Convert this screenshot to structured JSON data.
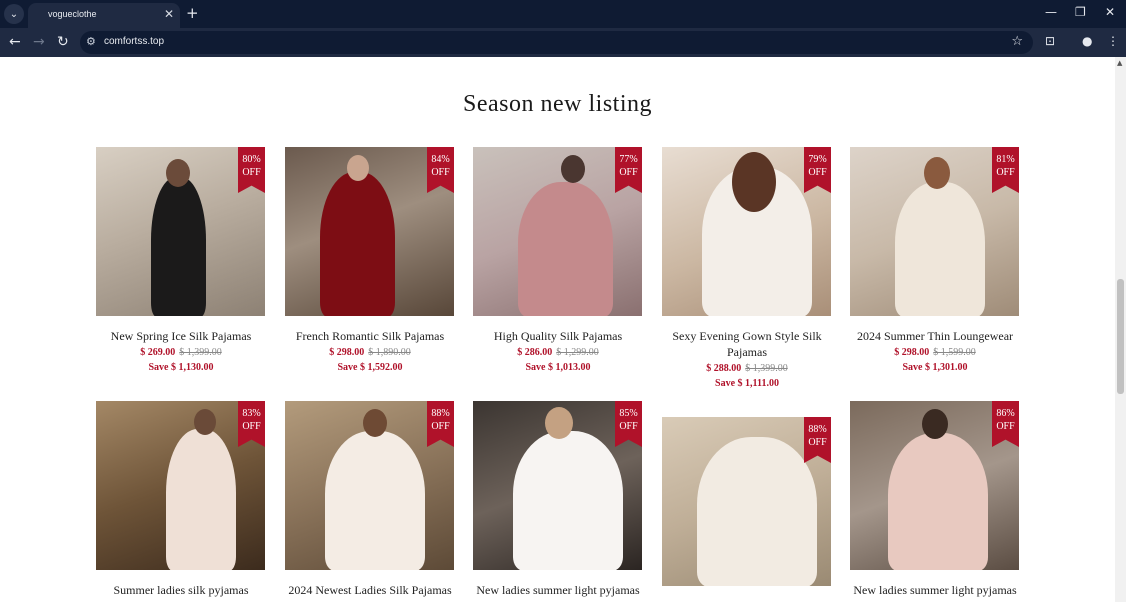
{
  "browser": {
    "tab_title": "vogueclothe",
    "url": "comfortss.top"
  },
  "section": {
    "title": "Season new listing"
  },
  "products": [
    {
      "name": "New Spring Ice Silk Pajamas",
      "price": "$ 269.00",
      "original": "$ 1,399.00",
      "save": "Save $ 1,130.00",
      "discount_pct": "80%",
      "discount_off": "OFF"
    },
    {
      "name": "French Romantic Silk Pajamas",
      "price": "$ 298.00",
      "original": "$ 1,890.00",
      "save": "Save $ 1,592.00",
      "discount_pct": "84%",
      "discount_off": "OFF"
    },
    {
      "name": "High Quality Silk Pajamas",
      "price": "$ 286.00",
      "original": "$ 1,299.00",
      "save": "Save $ 1,013.00",
      "discount_pct": "77%",
      "discount_off": "OFF"
    },
    {
      "name": "Sexy Evening Gown Style Silk Pajamas",
      "price": "$ 288.00",
      "original": "$ 1,399.00",
      "save": "Save $ 1,111.00",
      "discount_pct": "79%",
      "discount_off": "OFF"
    },
    {
      "name": "2024 Summer Thin Loungewear",
      "price": "$ 298.00",
      "original": "$ 1,599.00",
      "save": "Save $ 1,301.00",
      "discount_pct": "81%",
      "discount_off": "OFF"
    },
    {
      "name": "Summer ladies silk pyjamas",
      "discount_pct": "83%",
      "discount_off": "OFF"
    },
    {
      "name": "2024 Newest Ladies Silk Pajamas",
      "discount_pct": "88%",
      "discount_off": "OFF"
    },
    {
      "name": "New ladies summer light pyjamas",
      "discount_pct": "85%",
      "discount_off": "OFF"
    },
    {
      "name": "",
      "discount_pct": "88%",
      "discount_off": "OFF"
    },
    {
      "name": "New ladies summer light pyjamas",
      "discount_pct": "86%",
      "discount_off": "OFF"
    }
  ]
}
